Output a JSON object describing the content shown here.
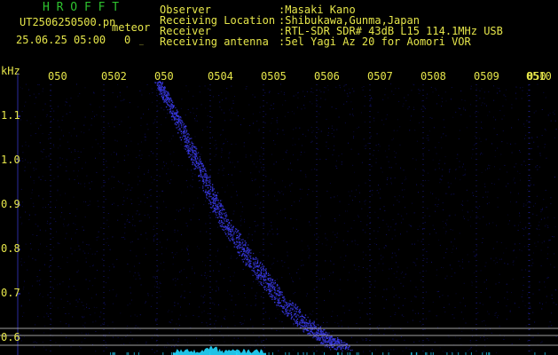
{
  "header": {
    "app_name": "H R O F F T",
    "filename": "UT2506250500.pn",
    "mode": "meteor",
    "datetime": "25.06.25 05:00",
    "count": "0",
    "count_suffix": "_",
    "fields": [
      {
        "label": "Observer",
        "value": ":Masaki Kano"
      },
      {
        "label": "Receiving Location",
        "value": ":Shibukawa,Gunma,Japan"
      },
      {
        "label": "Receiver",
        "value": ":RTL-SDR SDR# 43dB L15 114.1MHz USB"
      },
      {
        "label": "Receiving antenna",
        "value": ":5el Yagi Az 20 for Aomori VOR"
      }
    ]
  },
  "axes": {
    "y_unit": "kHz",
    "y_ticks": [
      "1.1",
      "1.0",
      "0.9",
      "0.8",
      "0.7",
      "0.6"
    ],
    "x_ticks": [
      "050",
      "050",
      "050",
      "050",
      "050",
      "050",
      "050",
      "050",
      "050",
      "050",
      "0510"
    ],
    "x_tick_cut": [
      "",
      "2",
      "",
      "4",
      "5",
      "6",
      "7",
      "8",
      "9",
      "",
      ""
    ]
  },
  "colors": {
    "background": "#000000",
    "header_text": "#e6e64a",
    "app_name": "#2ec22e",
    "signal": "#3a3aff",
    "noise": "#0c0c5a",
    "baseline": "#22d8ff",
    "grid": "#bbbbbb"
  }
}
